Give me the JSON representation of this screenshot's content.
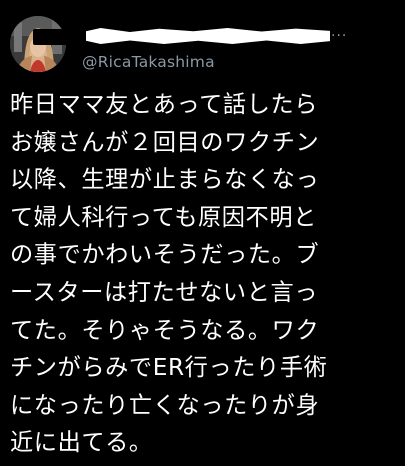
{
  "tweet": {
    "more_label": "···",
    "handle": "@RicaTakashima",
    "body_lines": [
      "昨日ママ友とあって話したら",
      "お嬢さんが２回目のワクチン",
      "以降、生理が止まらなくなっ",
      "て婦人科行っても原因不明と",
      "の事でかわいそうだった。ブ",
      "ースターは打たせないと言っ",
      "てた。そりゃそうなる。ワク",
      "チンがらみでER行ったり手術",
      "になったり亡くなったりが身",
      "近に出てる。"
    ]
  },
  "colors": {
    "background": "#000000",
    "text": "#ffffff",
    "secondary_text": "#8b98a5"
  }
}
